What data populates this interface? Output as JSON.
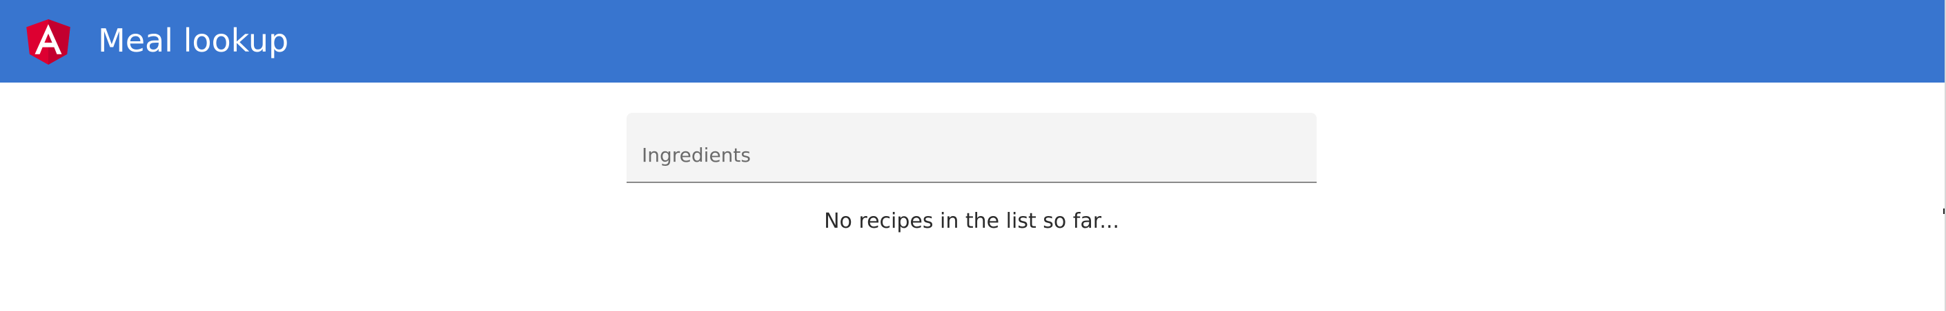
{
  "toolbar": {
    "title": "Meal lookup",
    "logo_icon": "angular-logo-icon",
    "background_color": "#3875cf",
    "logo_color": "#c3002f"
  },
  "search": {
    "placeholder": "Ingredients",
    "value": ""
  },
  "results": {
    "empty_message": "No recipes in the list so far..."
  }
}
